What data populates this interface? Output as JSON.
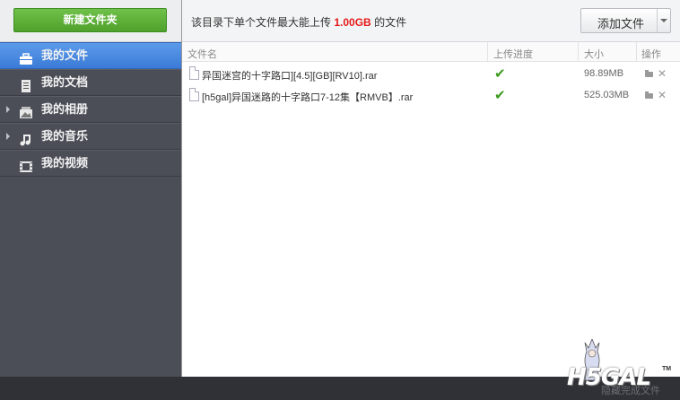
{
  "sidebar": {
    "new_folder_label": "新建文件夹",
    "items": [
      {
        "label": "我的文件",
        "icon": "briefcase-icon",
        "active": true
      },
      {
        "label": "我的文档",
        "icon": "document-icon",
        "active": false
      },
      {
        "label": "我的相册",
        "icon": "photo-album-icon",
        "active": false
      },
      {
        "label": "我的音乐",
        "icon": "music-note-icon",
        "active": false
      },
      {
        "label": "我的视频",
        "icon": "film-icon",
        "active": false
      }
    ]
  },
  "toolbar": {
    "notice_prefix": "该目录下单个文件最大能上传",
    "notice_limit": "1.00GB",
    "notice_suffix": "的文件",
    "add_file_label": "添加文件"
  },
  "table": {
    "columns": [
      "文件名",
      "上传进度",
      "大小",
      "操作"
    ],
    "rows": [
      {
        "name": "异国迷宫的十字路口][4.5][GB][RV10].rar",
        "progress": "完成",
        "size": "98.89MB"
      },
      {
        "name": "[h5gal]异国迷路的十字路口7-12集【RMVB】.rar",
        "progress": "完成",
        "size": "525.03MB"
      }
    ]
  },
  "watermark": {
    "logo_text": "H5GAL",
    "tm": "TM"
  },
  "footer": {
    "text": "隐藏完成文件"
  },
  "colors": {
    "accent_blue": "#3b7bd7",
    "button_green": "#4fa12b",
    "limit_red": "#e4191a",
    "sidebar_bg": "#4b4e57",
    "check_green": "#3a9a1c"
  }
}
